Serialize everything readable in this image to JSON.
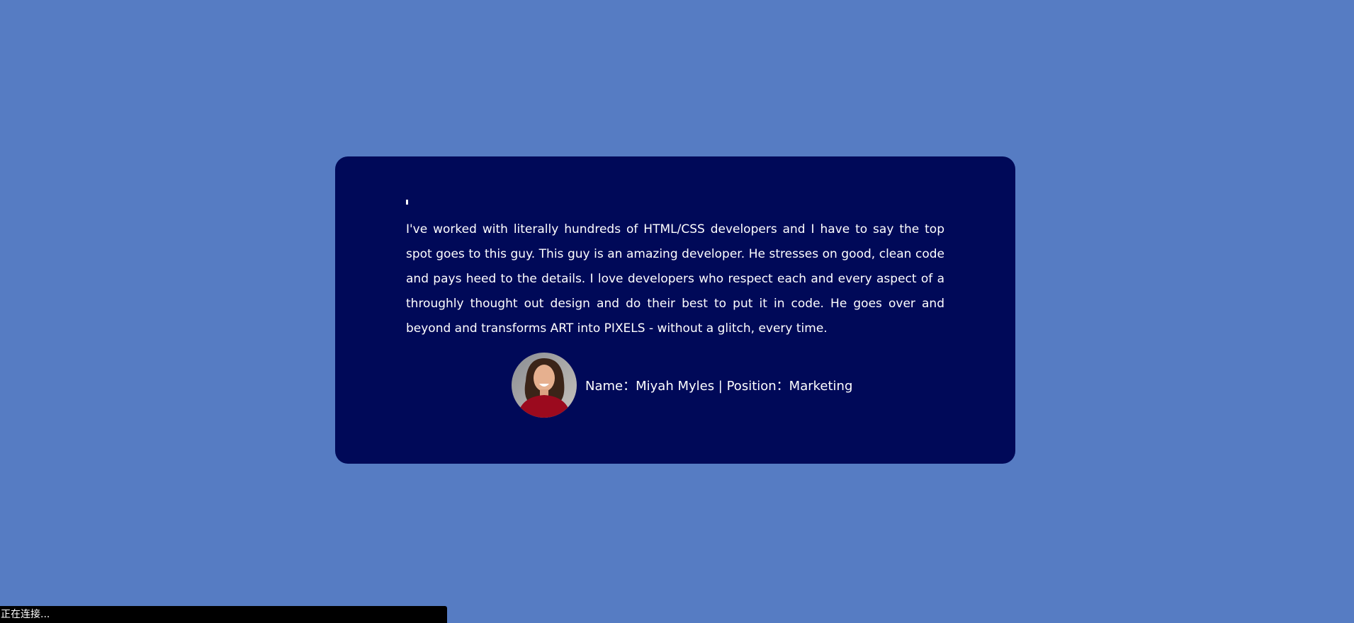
{
  "testimonial": {
    "quote_icon": "quote-icon",
    "text": "I've worked with literally hundreds of HTML/CSS developers and I have to say the top spot goes to this guy. This guy is an amazing developer. He stresses on good, clean code and pays heed to the details. I love developers who respect each and every aspect of a throughly thought out design and do their best to put it in code. He goes over and beyond and transforms ART into PIXELS - without a glitch, every time.",
    "author_line": "Name：Miyah Myles | Position：Marketing"
  },
  "status": {
    "text": "正在连接..."
  },
  "colors": {
    "background": "#567cc3",
    "card": "#000958",
    "text": "#ffffff"
  }
}
